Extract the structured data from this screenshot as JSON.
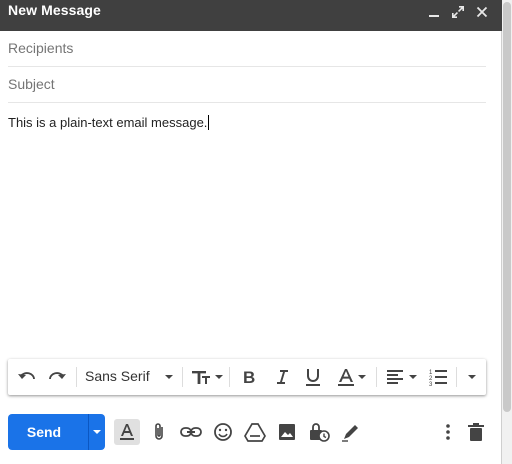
{
  "window": {
    "title": "New Message"
  },
  "fields": {
    "recipients_placeholder": "Recipients",
    "subject_placeholder": "Subject"
  },
  "body": {
    "text": "This is a plain-text email message."
  },
  "formatting": {
    "font_name": "Sans Serif"
  },
  "send": {
    "label": "Send"
  },
  "colors": {
    "titlebar": "#404040",
    "send": "#1a73e8"
  },
  "icons": {
    "titlebar": [
      "minimize-icon",
      "expand-icon",
      "close-icon"
    ],
    "formatting": [
      "undo-icon",
      "redo-icon",
      "font-dropdown-icon",
      "text-size-icon",
      "bold-icon",
      "italic-icon",
      "underline-icon",
      "text-color-icon",
      "align-icon",
      "numbered-list-icon",
      "more-formatting-icon"
    ],
    "bottom": [
      "formatting-options-icon",
      "attach-icon",
      "link-icon",
      "emoji-icon",
      "drive-icon",
      "photo-icon",
      "confidential-icon",
      "signature-icon",
      "more-options-icon",
      "discard-icon"
    ]
  }
}
